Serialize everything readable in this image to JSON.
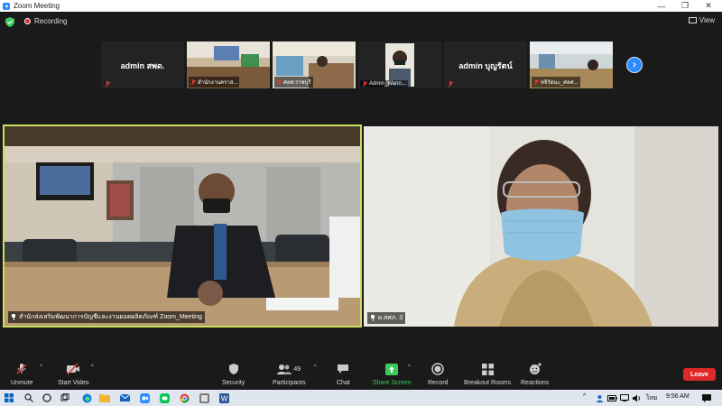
{
  "window": {
    "title": "Zoom Meeting"
  },
  "top": {
    "recording_label": "Recording",
    "view_label": "View"
  },
  "thumbnails": [
    {
      "name": "admin สพด.",
      "label": ""
    },
    {
      "name": "",
      "label": "สำนักงานคราส..."
    },
    {
      "name": "",
      "label": "ศลศ.ราชบุรี"
    },
    {
      "name": "",
      "label": "Admin_Wann..."
    },
    {
      "name": "admin บุญรัตน์",
      "label": ""
    },
    {
      "name": "",
      "label": "หจิรัตนะ_ศลศ..."
    }
  ],
  "videos": {
    "left_label": "สำนักส่งเสริมพัฒนาการบัญชีและงานยอดผลิตภัณฑ์ Zoom_Meeting",
    "right_label": "ผ.สศภ. 3"
  },
  "toolbar": {
    "unmute": "Unmute",
    "start_video": "Start Video",
    "security": "Security",
    "participants": "Participants",
    "participants_count": "49",
    "chat": "Chat",
    "share_screen": "Share Screen",
    "record": "Record",
    "breakout_rooms": "Breakout Rooms",
    "reactions": "Reactions",
    "leave": "Leave"
  },
  "taskbar": {
    "lang": "ไทย",
    "time": "9:56 AM"
  },
  "colors": {
    "accent": "#2d8cff",
    "leave": "#e02828",
    "share": "#3dca5c",
    "active_border": "#c8e05a"
  }
}
